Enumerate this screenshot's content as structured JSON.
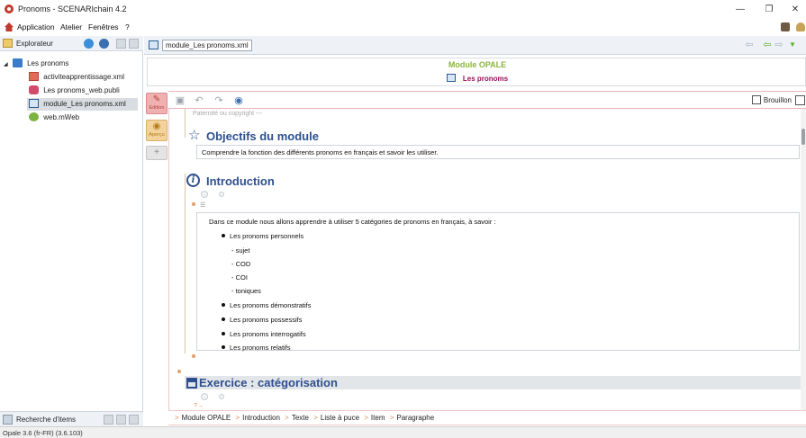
{
  "window": {
    "title": "Pronoms - SCENARIchain 4.2"
  },
  "menu": {
    "items": [
      "Application",
      "Atelier",
      "Fenêtres",
      "?"
    ]
  },
  "explorer": {
    "title": "Explorateur",
    "tree": {
      "root": "Les pronoms",
      "items": [
        {
          "label": "activiteapprentissage.xml",
          "icon": "activity-icon"
        },
        {
          "label": "Les pronoms_web.publi",
          "icon": "publication-icon"
        },
        {
          "label": "module_Les pronoms.xml",
          "icon": "module-icon",
          "selected": true
        },
        {
          "label": "web.mWeb",
          "icon": "web-icon"
        }
      ]
    },
    "footer": "Recherche d'items"
  },
  "status": "Opale 3.6 (fr-FR) (3.6.103)",
  "editor_tab": {
    "label": "module_Les pronoms.xml"
  },
  "module": {
    "type": "Module OPALE",
    "title": "Les pronoms"
  },
  "modes": {
    "edition": "Edition",
    "apercu": "Aperçu"
  },
  "toolbar": {
    "brouillon": "Brouillon"
  },
  "content": {
    "copyright_placeholder": "Paternité ou copyright ---",
    "objectifs": {
      "title": "Objectifs du module",
      "text": "Comprendre la fonction des différents pronoms en français et savoir les utiliser."
    },
    "introduction": {
      "title": "Introduction",
      "paragraph": "Dans ce module nous allons apprendre à utiliser 5 catégories de pronoms en français, à savoir :",
      "bullets": [
        "Les pronoms personnels",
        "Les pronoms démonstratifs",
        "Les pronoms possessifs",
        "Les pronoms interrogatifs",
        "Les pronoms relatifs"
      ],
      "subitems": [
        "- sujet",
        "- COD",
        "- COI",
        "- toniques"
      ]
    },
    "exercice": {
      "title": "Exercice : catégorisation"
    }
  },
  "breadcrumb": [
    "Module OPALE",
    "Introduction",
    "Texte",
    "Liste à puce",
    "Item",
    "Paragraphe"
  ],
  "colors": {
    "accent_blue": "#2e4f8e",
    "module_green": "#8bb53f",
    "title_magenta": "#9a0f5a",
    "separator_orange": "#e58a55"
  }
}
